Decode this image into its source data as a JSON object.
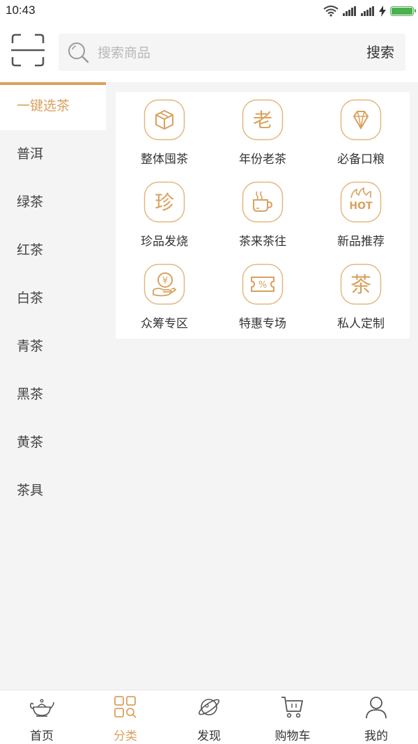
{
  "status_bar": {
    "time": "10:43"
  },
  "search": {
    "placeholder": "搜索商品",
    "button_label": "搜索"
  },
  "sidebar": {
    "items": [
      {
        "label": "一键选茶",
        "active": true
      },
      {
        "label": "普洱"
      },
      {
        "label": "绿茶"
      },
      {
        "label": "红茶"
      },
      {
        "label": "白茶"
      },
      {
        "label": "青茶"
      },
      {
        "label": "黑茶"
      },
      {
        "label": "黄茶"
      },
      {
        "label": "茶具"
      }
    ]
  },
  "categories": [
    {
      "label": "整体囤茶",
      "icon": "box-icon"
    },
    {
      "label": "年份老茶",
      "icon": "lao-character-icon",
      "glyph": "老"
    },
    {
      "label": "必备口粮",
      "icon": "diamond-icon"
    },
    {
      "label": "珍品发烧",
      "icon": "zhen-character-icon",
      "glyph": "珍"
    },
    {
      "label": "茶来茶往",
      "icon": "tea-cup-icon"
    },
    {
      "label": "新品推荐",
      "icon": "hot-icon",
      "badge": "HOT"
    },
    {
      "label": "众筹专区",
      "icon": "yuan-hand-icon",
      "glyph": "¥"
    },
    {
      "label": "特惠专场",
      "icon": "coupon-icon",
      "glyph": "%"
    },
    {
      "label": "私人定制",
      "icon": "cha-character-icon",
      "glyph": "茶"
    }
  ],
  "bottom_nav": {
    "items": [
      {
        "label": "首页",
        "icon": "teapot-icon"
      },
      {
        "label": "分类",
        "icon": "category-grid-icon",
        "active": true
      },
      {
        "label": "发现",
        "icon": "planet-icon"
      },
      {
        "label": "购物车",
        "icon": "cart-icon"
      },
      {
        "label": "我的",
        "icon": "user-icon"
      }
    ]
  },
  "colors": {
    "accent": "#d9a15e",
    "background": "#f4f4f4",
    "battery": "#4caf50"
  },
  "battery_level": 1.0
}
